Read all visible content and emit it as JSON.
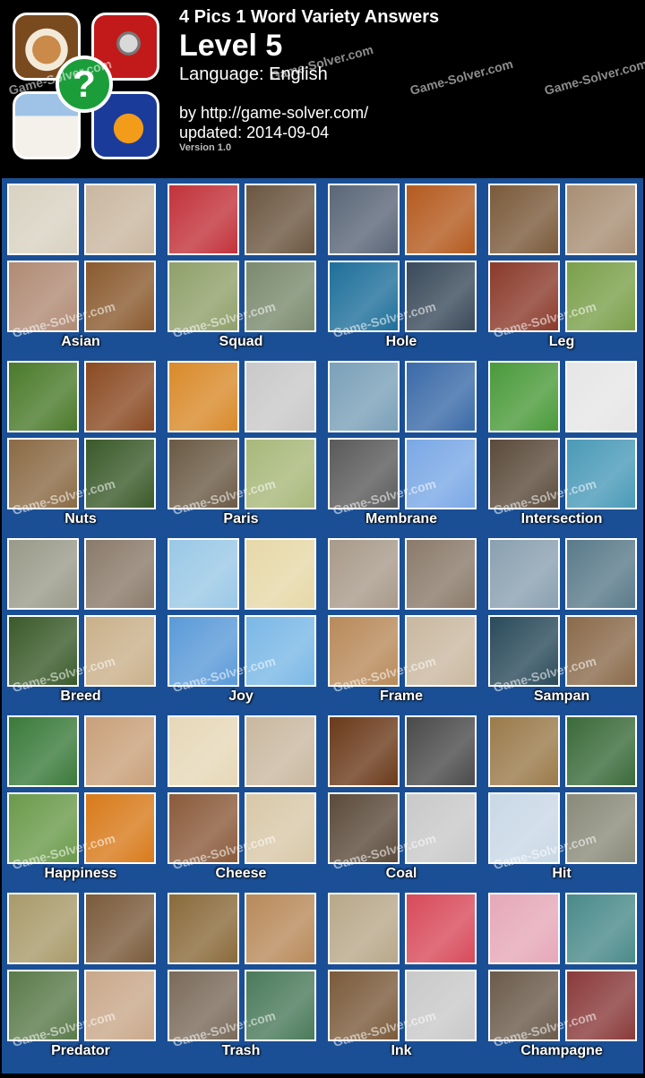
{
  "header": {
    "title": "4 Pics 1 Word Variety Answers",
    "level": "Level 5",
    "language": "Language: English",
    "by": "by http://game-solver.com/",
    "updated": "updated: 2014-09-04",
    "version": "Version 1.0"
  },
  "watermark": "Game-Solver.com",
  "puzzles": [
    {
      "answer": "Asian",
      "colors": [
        "#d9d2c2",
        "#c9b7a0",
        "#b08a74",
        "#8a5a2e"
      ]
    },
    {
      "answer": "Squad",
      "colors": [
        "#c2323a",
        "#6b5640",
        "#8fa06a",
        "#7a8a6e"
      ]
    },
    {
      "answer": "Hole",
      "colors": [
        "#5a6677",
        "#b45a1e",
        "#1e6f9a",
        "#3a4a5a"
      ]
    },
    {
      "answer": "Leg",
      "colors": [
        "#7a5a3a",
        "#a88e74",
        "#8a3a2a",
        "#7aa04a"
      ]
    },
    {
      "answer": "Nuts",
      "colors": [
        "#4a7a2a",
        "#8a4a22",
        "#8a6a44",
        "#3a5a2a"
      ]
    },
    {
      "answer": "Paris",
      "colors": [
        "#d98a2a",
        "#c9c9c9",
        "#6a5a44",
        "#a8b87a"
      ]
    },
    {
      "answer": "Membrane",
      "colors": [
        "#7aa0b8",
        "#3a6aa8",
        "#5a5a5a",
        "#7aa8e6"
      ]
    },
    {
      "answer": "Intersection",
      "colors": [
        "#4a9a3a",
        "#e6e6e6",
        "#5a4a3a",
        "#4a9ab8"
      ]
    },
    {
      "answer": "Breed",
      "colors": [
        "#9a9a8a",
        "#8a7a6a",
        "#3a5a2a",
        "#c9b08a"
      ]
    },
    {
      "answer": "Joy",
      "colors": [
        "#9ac8e6",
        "#e6d8a8",
        "#5a9ad8",
        "#7ab8e6"
      ]
    },
    {
      "answer": "Frame",
      "colors": [
        "#a89a8a",
        "#8a7a6a",
        "#b88a5a",
        "#c9b8a0"
      ]
    },
    {
      "answer": "Sampan",
      "colors": [
        "#8aa0b0",
        "#5a7a8a",
        "#2a4a5a",
        "#8a6a4a"
      ]
    },
    {
      "answer": "Happiness",
      "colors": [
        "#3a7a3a",
        "#c9a07a",
        "#6a9a4a",
        "#d87a1a"
      ]
    },
    {
      "answer": "Cheese",
      "colors": [
        "#e6d8b8",
        "#c9b8a0",
        "#8a5a3a",
        "#d8c8a8"
      ]
    },
    {
      "answer": "Coal",
      "colors": [
        "#6a3a1a",
        "#4a4a4a",
        "#5a4a3a",
        "#c9c9c9"
      ]
    },
    {
      "answer": "Hit",
      "colors": [
        "#9a7a4a",
        "#3a6a3a",
        "#c9d8e6",
        "#8a8a7a"
      ]
    },
    {
      "answer": "Predator",
      "colors": [
        "#a89a6a",
        "#7a5a3a",
        "#5a7a4a",
        "#c9a88a"
      ]
    },
    {
      "answer": "Trash",
      "colors": [
        "#8a6a3a",
        "#b88a5a",
        "#7a6a5a",
        "#4a7a5a"
      ]
    },
    {
      "answer": "Ink",
      "colors": [
        "#b8a88a",
        "#d84a5a",
        "#7a5a3a",
        "#c9c9c9"
      ]
    },
    {
      "answer": "Champagne",
      "colors": [
        "#e6a8b8",
        "#4a8a8a",
        "#6a5a4a",
        "#8a3a3a"
      ]
    }
  ]
}
